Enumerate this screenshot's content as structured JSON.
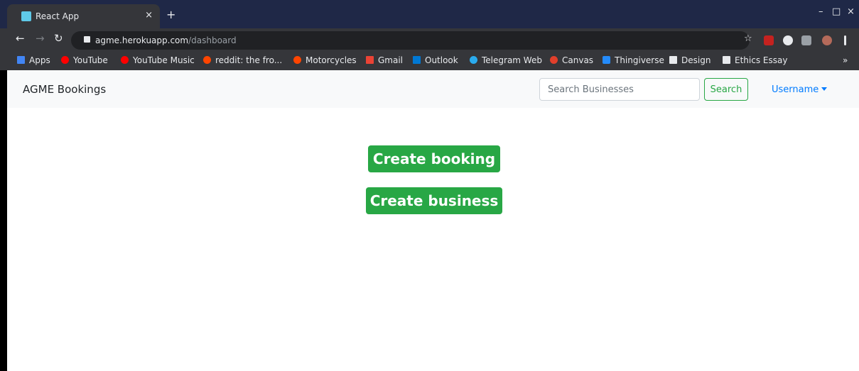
{
  "browser": {
    "tab_title": "React App",
    "tab_close": "×",
    "new_tab": "+",
    "window_controls": [
      "–",
      "□",
      "×"
    ],
    "url_host": "agme.herokuapp.com",
    "url_path": "/dashboard",
    "bookmarks": [
      {
        "label": "Apps",
        "color": "#4285f4"
      },
      {
        "label": "YouTube",
        "color": "#ff0000"
      },
      {
        "label": "YouTube Music",
        "color": "#ff0000"
      },
      {
        "label": "reddit: the fro...",
        "color": "#ff4500"
      },
      {
        "label": "Motorcycles",
        "color": "#ff4500"
      },
      {
        "label": "Gmail",
        "color": "#ea4335"
      },
      {
        "label": "Outlook",
        "color": "#0078d4"
      },
      {
        "label": "Telegram Web",
        "color": "#2aabee"
      },
      {
        "label": "Canvas",
        "color": "#e13f2b"
      },
      {
        "label": "Thingiverse",
        "color": "#248bfb"
      },
      {
        "label": "Design",
        "color": "#e8eaed"
      },
      {
        "label": "Ethics Essay",
        "color": "#e8eaed"
      }
    ],
    "overflow": "»"
  },
  "navbar": {
    "brand": "AGME Bookings",
    "search_placeholder": "Search Businesses",
    "search_button": "Search",
    "user_menu": "Username"
  },
  "main": {
    "create_booking": "Create booking",
    "create_business": "Create business"
  },
  "colors": {
    "success": "#28a745",
    "link": "#007bff",
    "navbar_bg": "#f8f9fa"
  }
}
